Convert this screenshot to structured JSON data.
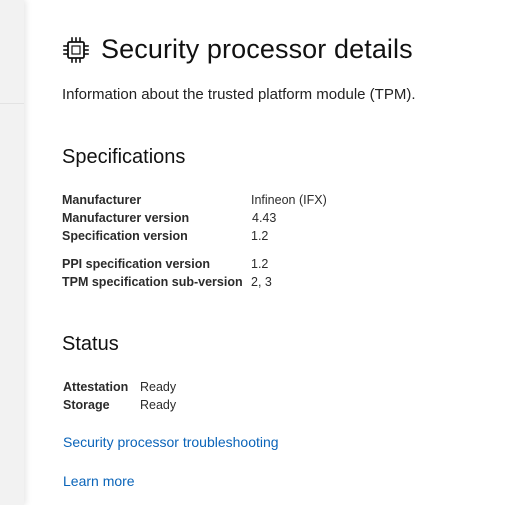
{
  "page": {
    "title": "Security processor details",
    "subtitle": "Information about the trusted platform module (TPM)."
  },
  "specifications": {
    "heading": "Specifications",
    "rows": [
      {
        "label": "Manufacturer",
        "value": "Infineon (IFX)"
      },
      {
        "label": "Manufacturer version",
        "value": "4.43"
      },
      {
        "label": "Specification version",
        "value": "1.2"
      },
      {
        "label": "PPI specification version",
        "value": "1.2"
      },
      {
        "label": "TPM specification sub-version",
        "value": "2, 3"
      }
    ]
  },
  "status": {
    "heading": "Status",
    "rows": [
      {
        "label": "Attestation",
        "value": "Ready"
      },
      {
        "label": "Storage",
        "value": "Ready"
      }
    ]
  },
  "links": {
    "troubleshooting": "Security processor troubleshooting",
    "learn_more": "Learn more"
  },
  "icons": {
    "title_icon": "processor-chip-icon"
  },
  "colors": {
    "link": "#0a64b9",
    "nav_background": "#f2f2f2"
  }
}
